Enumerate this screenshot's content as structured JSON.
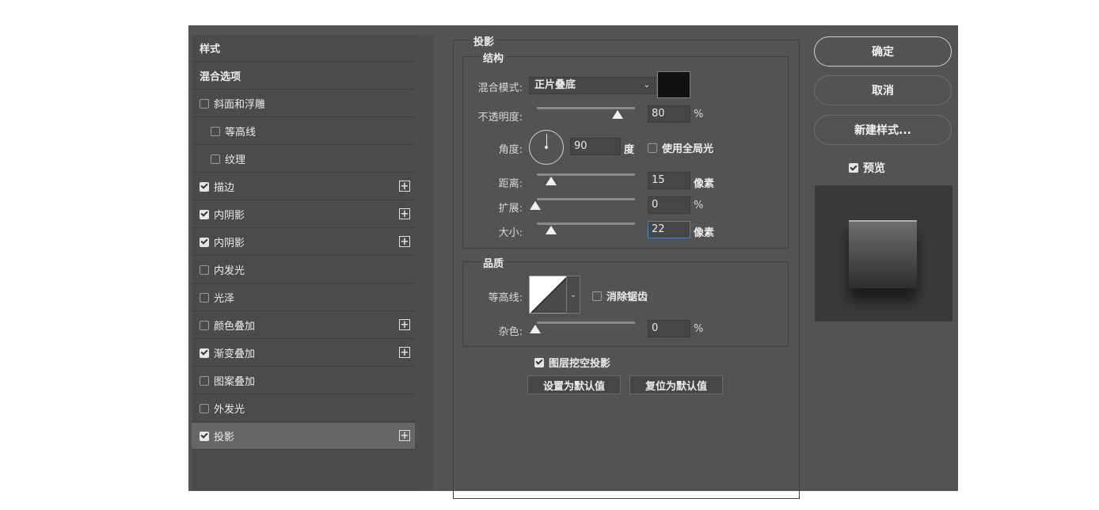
{
  "style_list": {
    "header": "样式",
    "blend_options": "混合选项",
    "items": [
      {
        "label": "斜面和浮雕",
        "checked": false,
        "indent": false,
        "plus": false
      },
      {
        "label": "等高线",
        "checked": false,
        "indent": true,
        "plus": false
      },
      {
        "label": "纹理",
        "checked": false,
        "indent": true,
        "plus": false
      },
      {
        "label": "描边",
        "checked": true,
        "indent": false,
        "plus": true
      },
      {
        "label": "内阴影",
        "checked": true,
        "indent": false,
        "plus": true
      },
      {
        "label": "内阴影",
        "checked": true,
        "indent": false,
        "plus": true
      },
      {
        "label": "内发光",
        "checked": false,
        "indent": false,
        "plus": false
      },
      {
        "label": "光泽",
        "checked": false,
        "indent": false,
        "plus": false
      },
      {
        "label": "颜色叠加",
        "checked": false,
        "indent": false,
        "plus": true
      },
      {
        "label": "渐变叠加",
        "checked": true,
        "indent": false,
        "plus": true
      },
      {
        "label": "图案叠加",
        "checked": false,
        "indent": false,
        "plus": false
      },
      {
        "label": "外发光",
        "checked": false,
        "indent": false,
        "plus": false
      },
      {
        "label": "投影",
        "checked": true,
        "indent": false,
        "plus": true,
        "active": true
      }
    ],
    "plus_glyph": "+"
  },
  "drop_shadow": {
    "title": "投影",
    "structure": {
      "legend": "结构",
      "blend_mode_label": "混合模式:",
      "blend_mode_value": "正片叠底",
      "chevron": "⌄",
      "shadow_color": "#111111",
      "opacity_label": "不透明度:",
      "opacity_value": "80",
      "opacity_unit": "%",
      "angle_label": "角度:",
      "angle_value": "90",
      "angle_unit": "度",
      "global_light_label": "使用全局光",
      "global_light_checked": false,
      "distance_label": "距离:",
      "distance_value": "15",
      "distance_unit": "像素",
      "spread_label": "扩展:",
      "spread_value": "0",
      "spread_unit": "%",
      "size_label": "大小:",
      "size_value": "22",
      "size_unit": "像素"
    },
    "quality": {
      "legend": "品质",
      "contour_label": "等高线:",
      "anti_alias_label": "消除锯齿",
      "anti_alias_checked": false,
      "noise_label": "杂色:",
      "noise_value": "0",
      "noise_unit": "%"
    },
    "knockout_label": "图层挖空投影",
    "knockout_checked": true,
    "set_default_button": "设置为默认值",
    "reset_default_button": "复位为默认值"
  },
  "actions": {
    "ok": "确定",
    "cancel": "取消",
    "new_style": "新建样式...",
    "preview_label": "预览",
    "preview_checked": true
  },
  "colors": {
    "dialog_bg": "#535353",
    "accent_focus": "#4a7fbf"
  }
}
